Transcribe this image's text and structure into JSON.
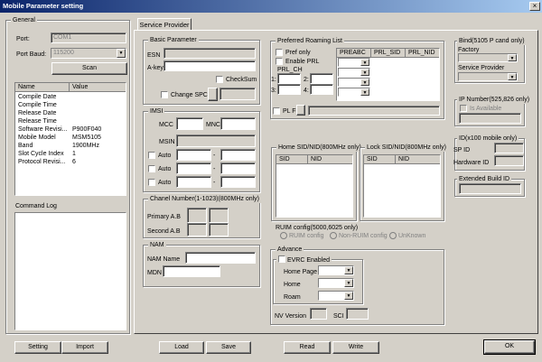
{
  "window": {
    "title": "Mobile Parameter setting",
    "close_glyph": "×"
  },
  "general": {
    "title": "General",
    "port_label": "Port:",
    "port_value": "COM1",
    "baud_label": "Port Baud:",
    "baud_value": "115200",
    "scan_label": "Scan",
    "table_headers": [
      "Name",
      "Value"
    ],
    "rows": [
      {
        "name": "Compile Date",
        "value": ""
      },
      {
        "name": "Compile Time",
        "value": ""
      },
      {
        "name": "Release Date",
        "value": ""
      },
      {
        "name": "Release Time",
        "value": ""
      },
      {
        "name": "Software Revisi...",
        "value": "P900F040"
      },
      {
        "name": "Mobile Model",
        "value": "MSM5105"
      },
      {
        "name": "Band",
        "value": "1900MHz"
      },
      {
        "name": "Slot Cycle Index",
        "value": "1"
      },
      {
        "name": "Protocol Revisi...",
        "value": "6"
      }
    ],
    "command_log_title": "Command Log"
  },
  "tab": {
    "label": "Service Provider"
  },
  "basic": {
    "title": "Basic Parameter",
    "esn_label": "ESN",
    "akey_label": "A-key",
    "checksum_label": "CheckSum",
    "change_spc_label": "Change SPC"
  },
  "imsi": {
    "title": "IMSI",
    "mcc_label": "MCC",
    "mnc_label": "MNC",
    "msin_label": "MSIN",
    "auto_labels": [
      "Auto",
      "Auto",
      "Auto"
    ],
    "dash": "-"
  },
  "channel": {
    "title": "Chanel Number(1-1023)(800MHz only)",
    "primary_label": "Primary A.B",
    "second_label": "Second A.B"
  },
  "nam": {
    "title": "NAM",
    "name_label": "NAM Name",
    "mdn_label": "MDN"
  },
  "roaming": {
    "title": "Preferred Roaming List",
    "pref_only_label": "Pref only",
    "enable_prl_label": "Enable PRL",
    "prl_ch_label": "PRL_CH",
    "slot_labels": [
      "1:",
      "2:",
      "3:",
      "4:"
    ],
    "table_headers": [
      "PREABC",
      "PRL_SID",
      "PRL_NID"
    ],
    "prl_file_label": "PL File"
  },
  "home_sid": {
    "title": "Home SID/NID(800MHz only)",
    "headers": [
      "SID",
      "NID"
    ]
  },
  "lock_sid": {
    "title": "Lock SID/NID(800MHz only)",
    "headers": [
      "SID",
      "NID"
    ]
  },
  "ruim": {
    "title": "RUIM config(5000,6025 only)",
    "options": [
      "RUIM config",
      "Non-RUIM config",
      "UnKnown"
    ]
  },
  "advance": {
    "title": "Advance",
    "evrc_label": "EVRC Enabled",
    "home_page_label": "Home Page",
    "home_label": "Home",
    "roam_label": "Roam",
    "nv_version_label": "NV Version",
    "sci_label": "SCI"
  },
  "bind": {
    "title": "Bind(5105 P cand only)",
    "factory_label": "Factory",
    "service_provider_label": "Service Provider"
  },
  "ip_number": {
    "title": "IP Number(525,826 only)",
    "is_available_label": "Is Available"
  },
  "id_box": {
    "title": "ID(x100 mobile only)",
    "sp_id_label": "SP ID",
    "hardware_id_label": "Hardware ID"
  },
  "extended": {
    "title": "Extended Build ID"
  },
  "buttons": {
    "setting": "Setting",
    "import": "Import",
    "load": "Load",
    "save": "Save",
    "read": "Read",
    "write": "Write",
    "ok": "OK"
  }
}
